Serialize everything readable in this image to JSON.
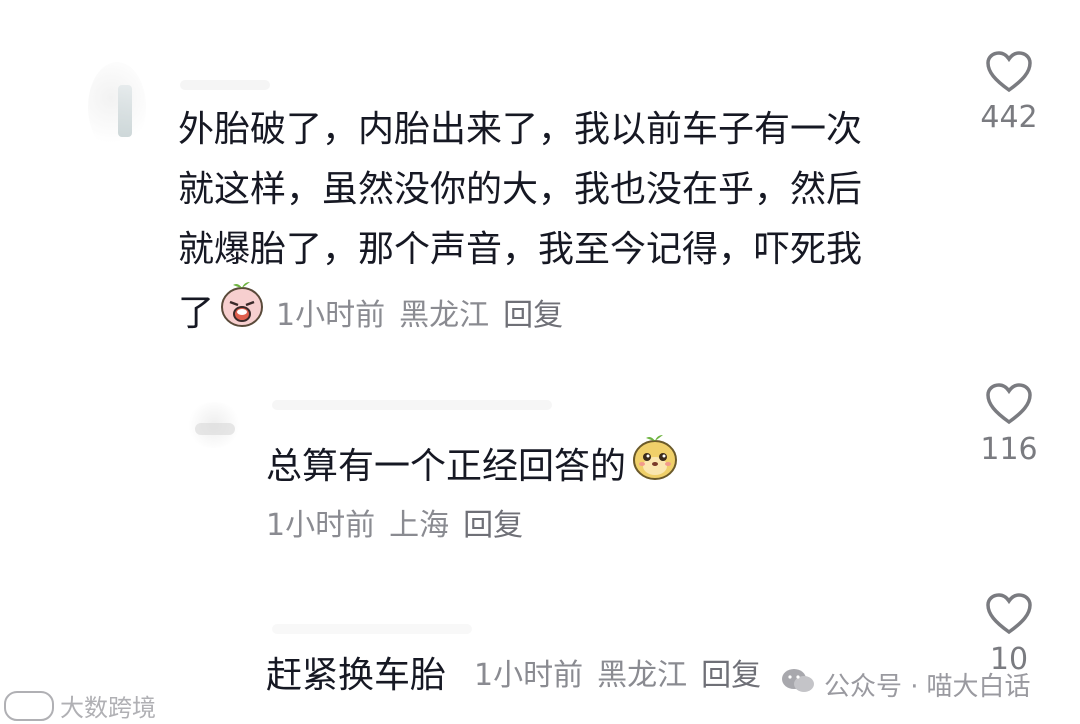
{
  "comments": [
    {
      "text": "外胎破了，内胎出来了，我以前车子有一次就这样，虽然没你的大，我也没在乎，然后就爆胎了，那个声音，我至今记得，吓死我了",
      "text_lines": [
        "外胎破了，内胎出来了，我以前车子有一次",
        "就这样，虽然没你的大，我也没在乎，然后",
        "就爆胎了，那个声音，我至今记得，吓死我"
      ],
      "last_line": "了",
      "emoji": "crying-face",
      "time": "1小时前",
      "location": "黑龙江",
      "reply_label": "回复",
      "likes": "442"
    },
    {
      "text": "总算有一个正经回答的",
      "emoji": "smiling-face",
      "time": "1小时前",
      "location": "上海",
      "reply_label": "回复",
      "likes": "116"
    },
    {
      "text": "赶紧换车胎",
      "time": "1小时前",
      "location": "黑龙江",
      "reply_label": "回复",
      "likes": "10"
    }
  ],
  "watermarks": {
    "left": "大数跨境",
    "right_prefix": "公众号 ·",
    "right": "喵大白话"
  },
  "colors": {
    "text": "#161823",
    "meta": "#8a8b91",
    "like": "#7a7b80"
  }
}
